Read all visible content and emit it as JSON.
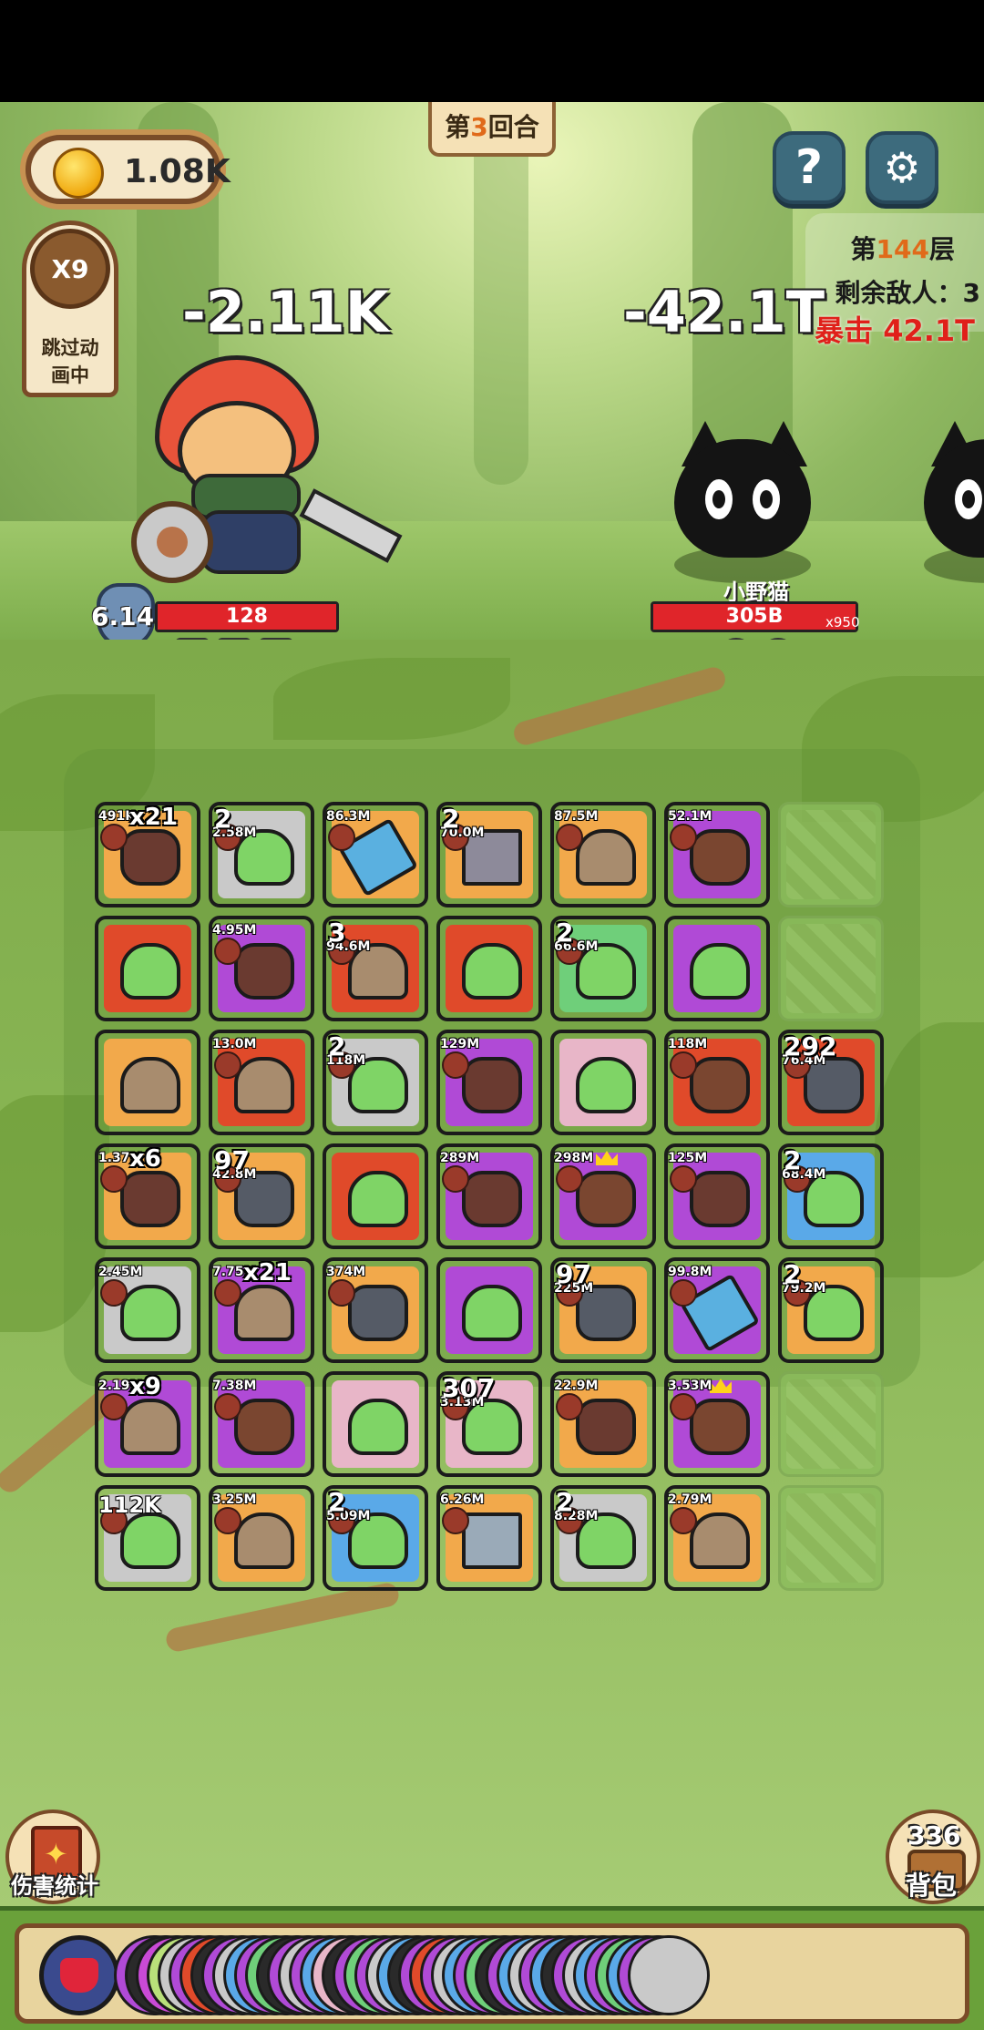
{
  "hud": {
    "gold": "1.08K",
    "round_prefix": "第",
    "round_number": "3",
    "round_suffix": "回合",
    "help_icon_glyph": "?",
    "settings_icon_glyph": "⚙",
    "speed_label": "X9",
    "skip_label_line1": "跳过动",
    "skip_label_line2": "画中"
  },
  "level": {
    "prefix": "第",
    "number": "144",
    "suffix": "层",
    "remaining_enemies": "剩余敌人：3",
    "crit_text": "暴击 42.1T"
  },
  "battle": {
    "hero_damage": "-2.11K",
    "enemy_damage": "-42.1T",
    "hero_armor": "6.14K",
    "hero_hp": "128",
    "enemy_name": "小野猫",
    "enemy_hp": "305B",
    "enemy_count": "x950"
  },
  "colors": {
    "orange": "#f2a94b",
    "gray": "#c9c9c9",
    "purple": "#b04ad6",
    "red": "#e04a2a",
    "green": "#6fcf7a",
    "blue": "#5aa9e8",
    "rainbow": "#e8b6c8"
  },
  "board": {
    "rows": [
      [
        {
          "bg": "orange",
          "sprite": "boar",
          "tag": "491K",
          "stack": "x21"
        },
        {
          "bg": "gray",
          "sprite": "slime",
          "tag": "2.58M",
          "lvl": "2"
        },
        {
          "bg": "orange",
          "sprite": "weapon",
          "tag": "86.3M"
        },
        {
          "bg": "orange",
          "sprite": "factory",
          "tag": "70.0M",
          "lvl": "2"
        },
        {
          "bg": "orange",
          "sprite": "person",
          "tag": "87.5M"
        },
        {
          "bg": "purple",
          "sprite": "bear",
          "tag": "52.1M"
        },
        {
          "empty": true
        }
      ],
      [
        {
          "bg": "red",
          "sprite": "slime",
          "tag": ""
        },
        {
          "bg": "purple",
          "sprite": "boar",
          "tag": "4.95M"
        },
        {
          "bg": "red",
          "sprite": "person",
          "tag": "94.6M",
          "lvl": "3"
        },
        {
          "bg": "red",
          "sprite": "slime",
          "tag": ""
        },
        {
          "bg": "green",
          "sprite": "slime",
          "tag": "66.6M",
          "lvl": "2"
        },
        {
          "bg": "purple",
          "sprite": "slime",
          "tag": ""
        },
        {
          "empty": true
        }
      ],
      [
        {
          "bg": "orange",
          "sprite": "person",
          "tag": ""
        },
        {
          "bg": "red",
          "sprite": "person",
          "tag": "13.0M"
        },
        {
          "bg": "gray",
          "sprite": "slime",
          "tag": "118M",
          "lvl": "2"
        },
        {
          "bg": "purple",
          "sprite": "boar",
          "tag": "129M"
        },
        {
          "bg": "rainbow",
          "sprite": "slime",
          "tag": ""
        },
        {
          "bg": "red",
          "sprite": "bear",
          "tag": "118M"
        },
        {
          "bg": "red",
          "sprite": "wolf",
          "tag": "76.4M",
          "lvl": "292"
        }
      ],
      [
        {
          "bg": "orange",
          "sprite": "boar",
          "tag": "1.37M",
          "stack": "x6"
        },
        {
          "bg": "orange",
          "sprite": "wolf",
          "tag": "42.8M",
          "lvl": "97"
        },
        {
          "bg": "red",
          "sprite": "slime",
          "tag": ""
        },
        {
          "bg": "purple",
          "sprite": "boar",
          "tag": "289M"
        },
        {
          "bg": "purple",
          "sprite": "bear",
          "tag": "298M",
          "crown": true
        },
        {
          "bg": "purple",
          "sprite": "boar",
          "tag": "125M"
        },
        {
          "bg": "blue",
          "sprite": "slime",
          "tag": "68.4M",
          "lvl": "2"
        }
      ],
      [
        {
          "bg": "gray",
          "sprite": "slime",
          "tag": "2.45M"
        },
        {
          "bg": "purple",
          "sprite": "person",
          "tag": "7.75M",
          "stack": "x21"
        },
        {
          "bg": "orange",
          "sprite": "wolf",
          "tag": "374M"
        },
        {
          "bg": "purple",
          "sprite": "slime",
          "tag": ""
        },
        {
          "bg": "orange",
          "sprite": "wolf",
          "tag": "225M",
          "lvl": "97"
        },
        {
          "bg": "purple",
          "sprite": "weapon",
          "tag": "99.8M"
        },
        {
          "bg": "orange",
          "sprite": "slime",
          "tag": "79.2M",
          "lvl": "2"
        }
      ],
      [
        {
          "bg": "purple",
          "sprite": "person",
          "tag": "2.19M",
          "stack": "x9"
        },
        {
          "bg": "purple",
          "sprite": "bear",
          "tag": "7.38M"
        },
        {
          "bg": "rainbow",
          "sprite": "slime",
          "tag": ""
        },
        {
          "bg": "rainbow",
          "sprite": "slime",
          "tag": "3.13M",
          "lvl": "307"
        },
        {
          "bg": "orange",
          "sprite": "boar",
          "tag": "22.9M"
        },
        {
          "bg": "purple",
          "sprite": "bear",
          "tag": "3.53M",
          "crown": true
        },
        {
          "empty": true
        }
      ],
      [
        {
          "bg": "gray",
          "sprite": "slime",
          "tag": "112K",
          "big": true
        },
        {
          "bg": "orange",
          "sprite": "person",
          "tag": "3.25M"
        },
        {
          "bg": "blue",
          "sprite": "slime",
          "tag": "5.09M",
          "lvl": "2"
        },
        {
          "bg": "orange",
          "sprite": "fence",
          "tag": "6.26M"
        },
        {
          "bg": "gray",
          "sprite": "slime",
          "tag": "8.28M",
          "lvl": "2"
        },
        {
          "bg": "orange",
          "sprite": "person",
          "tag": "2.79M"
        },
        {
          "empty": true
        }
      ]
    ]
  },
  "bottom": {
    "damage_stats_label": "伤害统计",
    "backpack_label": "背包",
    "backpack_count": "336"
  },
  "queue": {
    "colors": [
      "#b04ad6",
      "#2a2a2a",
      "#c94ad6",
      "#b9e07a",
      "#c9c9c9",
      "#b04ad6",
      "#e04a2a",
      "#2a2a2a",
      "#b04ad6",
      "#c9c9c9",
      "#5aa9e8",
      "#b04ad6",
      "#6fcf7a",
      "#2a2a2a",
      "#b04ad6",
      "#c9c9c9",
      "#b04ad6",
      "#5aa9e8",
      "#e8b6c8",
      "#2a2a2a",
      "#b04ad6",
      "#6fcf7a",
      "#b04ad6",
      "#c9c9c9",
      "#5aa9e8",
      "#2a2a2a",
      "#b04ad6",
      "#e04a2a",
      "#b04ad6",
      "#c9c9c9",
      "#5aa9e8",
      "#b04ad6",
      "#6fcf7a",
      "#2a2a2a",
      "#b04ad6",
      "#5aa9e8",
      "#c9c9c9",
      "#b04ad6",
      "#5aa9e8",
      "#2a2a2a",
      "#b04ad6",
      "#c9c9c9",
      "#5aa9e8",
      "#b04ad6",
      "#6fcf7a",
      "#5aa9e8",
      "#b04ad6",
      "#c9c9c9"
    ]
  }
}
